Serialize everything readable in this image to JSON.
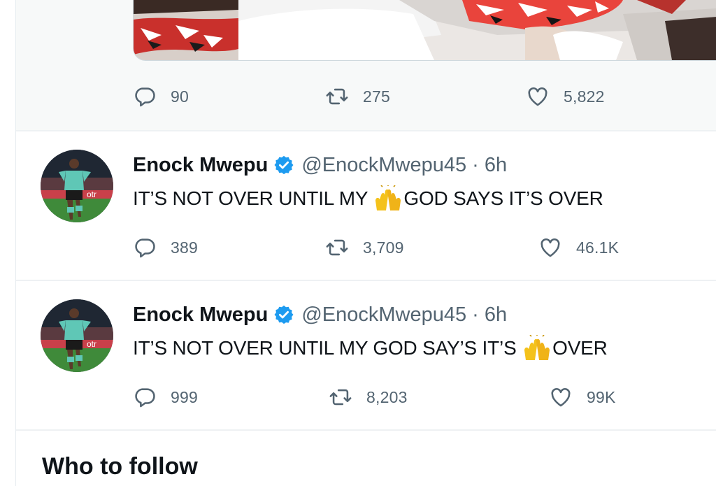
{
  "top_tweet": {
    "replies": "90",
    "retweets": "275",
    "likes": "5,822"
  },
  "tweets": [
    {
      "author_name": "Enock Mwepu",
      "handle": "@EnockMwepu45",
      "separator": "·",
      "time": "6h",
      "text_before": "IT’S NOT OVER UNTIL MY ",
      "emoji": "raising-hands-icon",
      "text_after": "GOD SAYS IT’S OVER",
      "replies": "389",
      "retweets": "3,709",
      "likes": "46.1K"
    },
    {
      "author_name": "Enock Mwepu",
      "handle": "@EnockMwepu45",
      "separator": "·",
      "time": "6h",
      "text_before": "IT’S NOT OVER UNTIL MY GOD SAY’S IT’S ",
      "emoji": "raising-hands-icon",
      "text_after": "OVER",
      "replies": "999",
      "retweets": "8,203",
      "likes": "99K"
    }
  ],
  "who_to_follow": {
    "title": "Who to follow"
  },
  "colors": {
    "text_primary": "#0f1419",
    "text_secondary": "#536471",
    "verified_blue": "#1d9bf0",
    "hover_bg": "#f7f9f9",
    "emoji_yellow": "#f4c21b"
  }
}
